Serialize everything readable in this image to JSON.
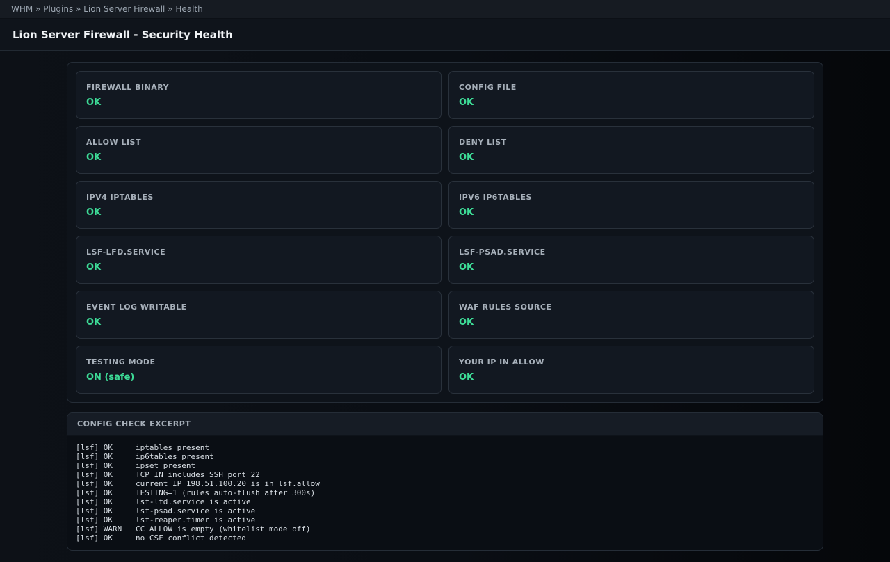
{
  "breadcrumb": "WHM » Plugins » Lion Server Firewall » Health",
  "page_title": "Lion Server Firewall - Security Health",
  "checks": [
    {
      "label": "FIREWALL BINARY",
      "status": "OK"
    },
    {
      "label": "CONFIG FILE",
      "status": "OK"
    },
    {
      "label": "ALLOW LIST",
      "status": "OK"
    },
    {
      "label": "DENY LIST",
      "status": "OK"
    },
    {
      "label": "IPV4 IPTABLES",
      "status": "OK"
    },
    {
      "label": "IPV6 IP6TABLES",
      "status": "OK"
    },
    {
      "label": "LSF-LFD.SERVICE",
      "status": "OK"
    },
    {
      "label": "LSF-PSAD.SERVICE",
      "status": "OK"
    },
    {
      "label": "EVENT LOG WRITABLE",
      "status": "OK"
    },
    {
      "label": "WAF RULES SOURCE",
      "status": "OK"
    },
    {
      "label": "TESTING MODE",
      "status": "ON (safe)"
    },
    {
      "label": "YOUR IP IN ALLOW",
      "status": "OK"
    }
  ],
  "status_color": "#3ddc97",
  "excerpt": {
    "title": "CONFIG CHECK EXCERPT",
    "lines": [
      {
        "prefix": "[lsf] OK",
        "message": "iptables present"
      },
      {
        "prefix": "[lsf] OK",
        "message": "ip6tables present"
      },
      {
        "prefix": "[lsf] OK",
        "message": "ipset present"
      },
      {
        "prefix": "[lsf] OK",
        "message": "TCP_IN includes SSH port 22"
      },
      {
        "prefix": "[lsf] OK",
        "message": "current IP 198.51.100.20 is in lsf.allow"
      },
      {
        "prefix": "[lsf] OK",
        "message": "TESTING=1 (rules auto-flush after 300s)"
      },
      {
        "prefix": "[lsf] OK",
        "message": "lsf-lfd.service is active"
      },
      {
        "prefix": "[lsf] OK",
        "message": "lsf-psad.service is active"
      },
      {
        "prefix": "[lsf] OK",
        "message": "lsf-reaper.timer is active"
      },
      {
        "prefix": "[lsf] WARN",
        "message": "CC_ALLOW is empty (whitelist mode off)"
      },
      {
        "prefix": "[lsf] OK",
        "message": "no CSF conflict detected"
      }
    ]
  }
}
